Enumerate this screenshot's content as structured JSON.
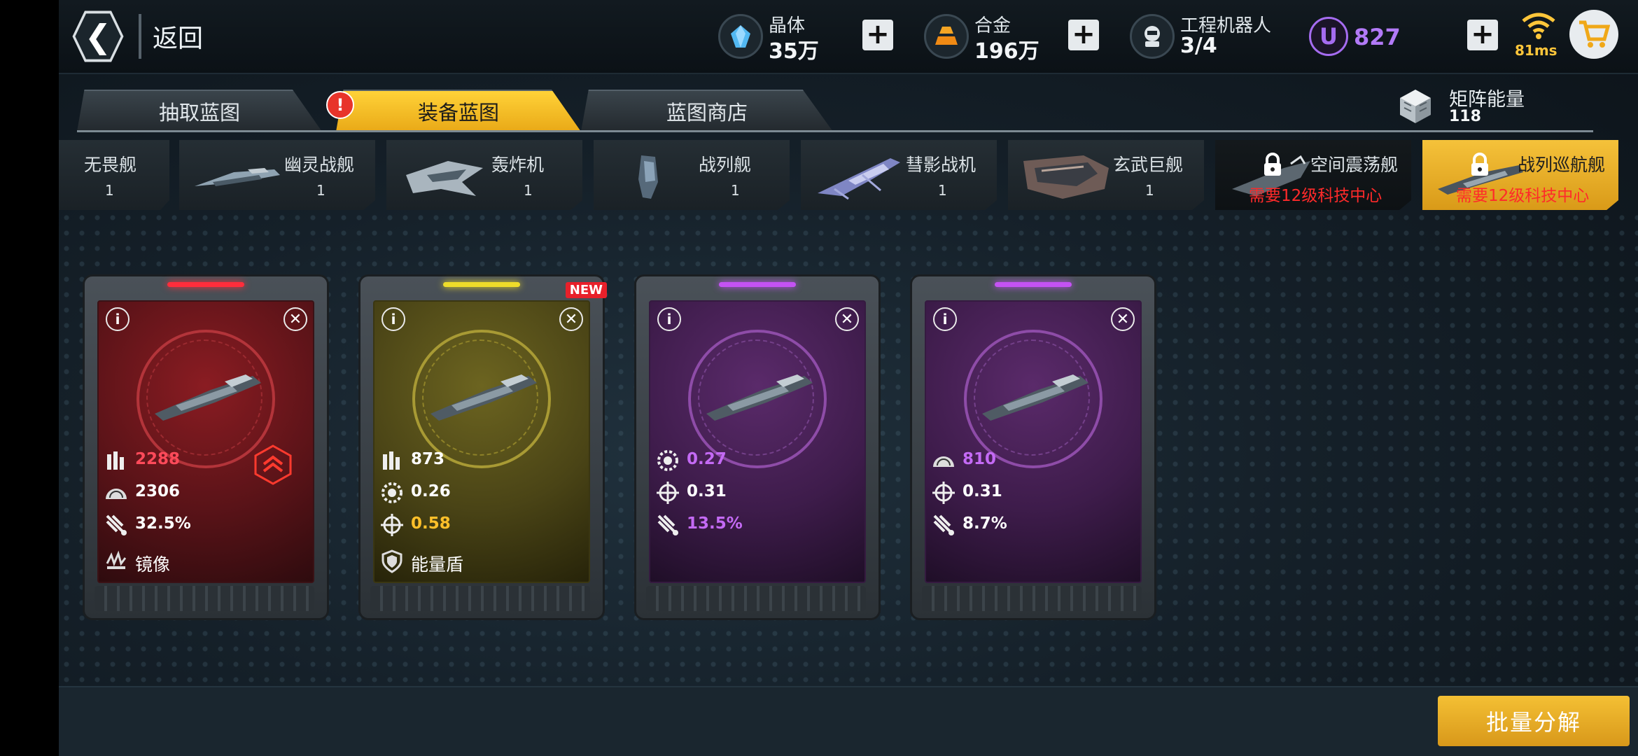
{
  "topbar": {
    "back_label": "返回",
    "resources": [
      {
        "name": "晶体",
        "value": "35万",
        "icon": "crystal-icon"
      },
      {
        "name": "合金",
        "value": "196万",
        "icon": "alloy-icon"
      },
      {
        "name": "工程机器人",
        "value": "3/4",
        "icon": "robot-icon"
      }
    ],
    "currency_symbol": "U",
    "currency_value": "827",
    "ping": "81ms"
  },
  "tabs": [
    {
      "label": "抽取蓝图",
      "active": false
    },
    {
      "label": "装备蓝图",
      "active": true,
      "alert": "!"
    },
    {
      "label": "蓝图商店",
      "active": false
    }
  ],
  "matrix_energy": {
    "label": "矩阵能量",
    "value": "118"
  },
  "categories": [
    {
      "name": "无畏舰",
      "count": "1"
    },
    {
      "name": "幽灵战舰",
      "count": "1"
    },
    {
      "name": "轰炸机",
      "count": "1"
    },
    {
      "name": "战列舰",
      "count": "1"
    },
    {
      "name": "彗影战机",
      "count": "1"
    },
    {
      "name": "玄武巨舰",
      "count": "1"
    },
    {
      "name": "空间震荡舰",
      "requirement": "需要12级科技中心",
      "locked": true
    },
    {
      "name": "战列巡航舰",
      "requirement": "需要12级科技中心",
      "locked": true,
      "selected": true
    }
  ],
  "cards": [
    {
      "rarity_color": "#e0262c",
      "stats": [
        {
          "icon": "ammo-icon",
          "value": "2288",
          "color": "#ff4a5a"
        },
        {
          "icon": "armor-icon",
          "value": "2306",
          "color": "#ffffff"
        },
        {
          "icon": "missile-icon",
          "value": "32.5%",
          "color": "#ffffff"
        },
        {
          "icon": "mirror-icon",
          "value": "镜像",
          "color": "#ffffff"
        }
      ]
    },
    {
      "rarity_color": "#e7d12a",
      "new_badge": "NEW",
      "stats": [
        {
          "icon": "ammo-icon",
          "value": "873",
          "color": "#ffffff"
        },
        {
          "icon": "gear-icon",
          "value": "0.26",
          "color": "#ffffff"
        },
        {
          "icon": "crosshair-icon",
          "value": "0.58",
          "color": "#ffc02a"
        },
        {
          "icon": "shield-icon",
          "value": "能量盾",
          "color": "#ffffff"
        }
      ]
    },
    {
      "rarity_color": "#b144e6",
      "stats": [
        {
          "icon": "gear-icon",
          "value": "0.27",
          "color": "#c46af5"
        },
        {
          "icon": "crosshair-icon",
          "value": "0.31",
          "color": "#ffffff"
        },
        {
          "icon": "missile-icon",
          "value": "13.5%",
          "color": "#c46af5"
        }
      ]
    },
    {
      "rarity_color": "#b144e6",
      "stats": [
        {
          "icon": "armor-icon",
          "value": "810",
          "color": "#c46af5"
        },
        {
          "icon": "crosshair-icon",
          "value": "0.31",
          "color": "#ffffff"
        },
        {
          "icon": "missile-icon",
          "value": "8.7%",
          "color": "#ffffff"
        }
      ]
    }
  ],
  "bulk_button": "批量分解"
}
